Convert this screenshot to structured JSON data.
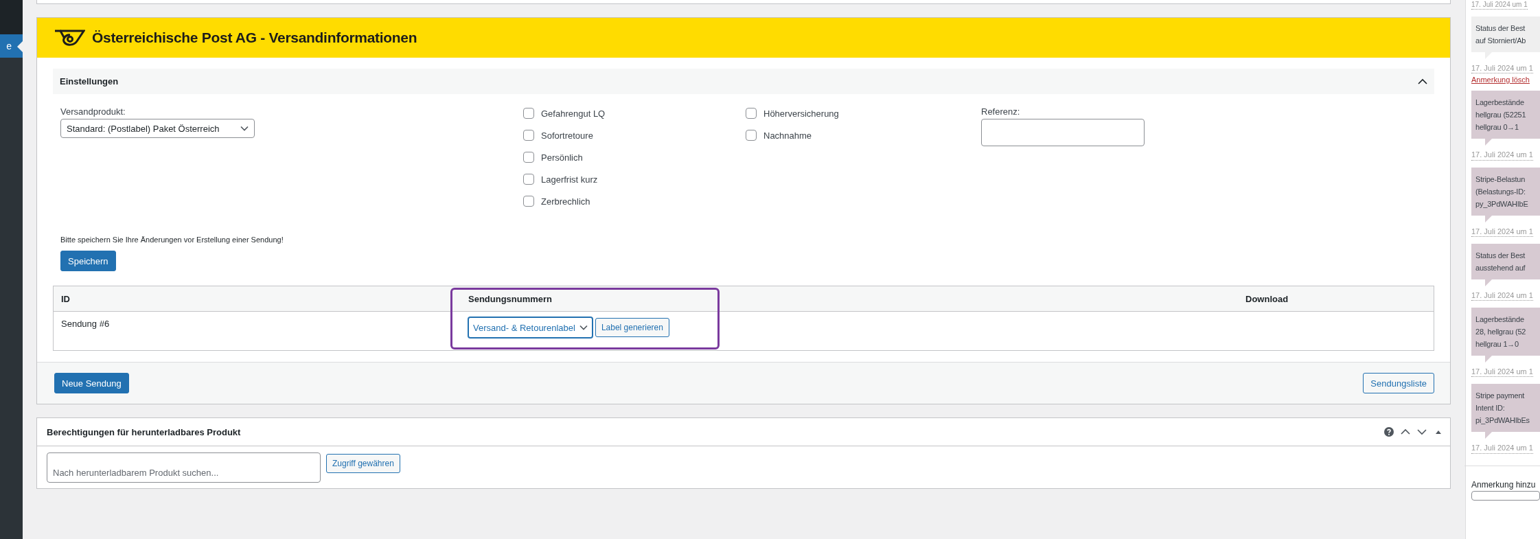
{
  "admin_menu": {
    "active_item": {
      "label": "e",
      "selected": true
    }
  },
  "shipping_box": {
    "title": "Österreichische Post AG - Versandinformationen",
    "settings": {
      "title": "Einstellungen",
      "expanded": true,
      "product": {
        "label": "Versandprodukt:",
        "value": "Standard: (Postlabel) Paket Österreich"
      },
      "option_groups": [
        [
          {
            "label": "Gefahrengut LQ",
            "checked": false
          },
          {
            "label": "Sofortretoure",
            "checked": false
          },
          {
            "label": "Persönlich",
            "checked": false
          },
          {
            "label": "Lagerfrist kurz",
            "checked": false
          },
          {
            "label": "Zerbrechlich",
            "checked": false
          }
        ],
        [
          {
            "label": "Höherversicherung",
            "checked": false
          },
          {
            "label": "Nachnahme",
            "checked": false
          }
        ]
      ],
      "reference": {
        "label": "Referenz:"
      }
    },
    "notice": "Bitte speichern Sie Ihre Änderungen vor Erstellung einer Sendung!",
    "save_button": "Speichern",
    "table": {
      "columns": [
        {
          "label": "ID",
          "highlighted": false
        },
        {
          "label": "Sendungsnummern",
          "highlighted": true
        },
        {
          "label": "Download",
          "highlighted": false
        }
      ],
      "rows": [
        {
          "id": "Sendung #6",
          "label_type": "Versand- & Retourenlabel",
          "generate_button": "Label generieren"
        }
      ]
    },
    "new_button": "Neue Sendung",
    "list_button": "Sendungsliste"
  },
  "downloads_box": {
    "title": "Berechtigungen für herunterladbares Produkt",
    "search": {
      "placeholder": "Nach herunterladbarem Produkt suchen..."
    },
    "grant_button": "Zugriff gewähren"
  },
  "notes": {
    "top_date": "17. Juli 2024 um 1",
    "items": [
      {
        "lines": [
          "Status der Best",
          "auf Storniert/Ab"
        ],
        "color": "#efefef",
        "date": "17. Juli 2024 um 1",
        "delete_link": "Anmerkung lösch"
      },
      {
        "lines": [
          "Lagerbestände",
          "hellgrau (52251",
          "hellgrau 0→1"
        ],
        "color": "#d7cad2",
        "date": "17. Juli 2024 um 1"
      },
      {
        "lines": [
          "Stripe-Belastun",
          "(Belastungs-ID:",
          "py_3PdWAHIbE"
        ],
        "color": "#d7cad2",
        "date": "17. Juli 2024 um 1"
      },
      {
        "lines": [
          "Status der Best",
          "ausstehend auf"
        ],
        "color": "#d7cad2",
        "date": "17. Juli 2024 um 1"
      },
      {
        "lines": [
          "Lagerbestände",
          "28, hellgrau (52",
          "hellgrau 1→0"
        ],
        "color": "#d7cad2",
        "date": "17. Juli 2024 um 1"
      },
      {
        "lines": [
          "Stripe payment",
          "Intent ID:",
          "pi_3PdWAHIbEs"
        ],
        "color": "#d7cad2",
        "date": "17. Juli 2024 um 1"
      }
    ],
    "add_label": "Anmerkung hinzu"
  }
}
